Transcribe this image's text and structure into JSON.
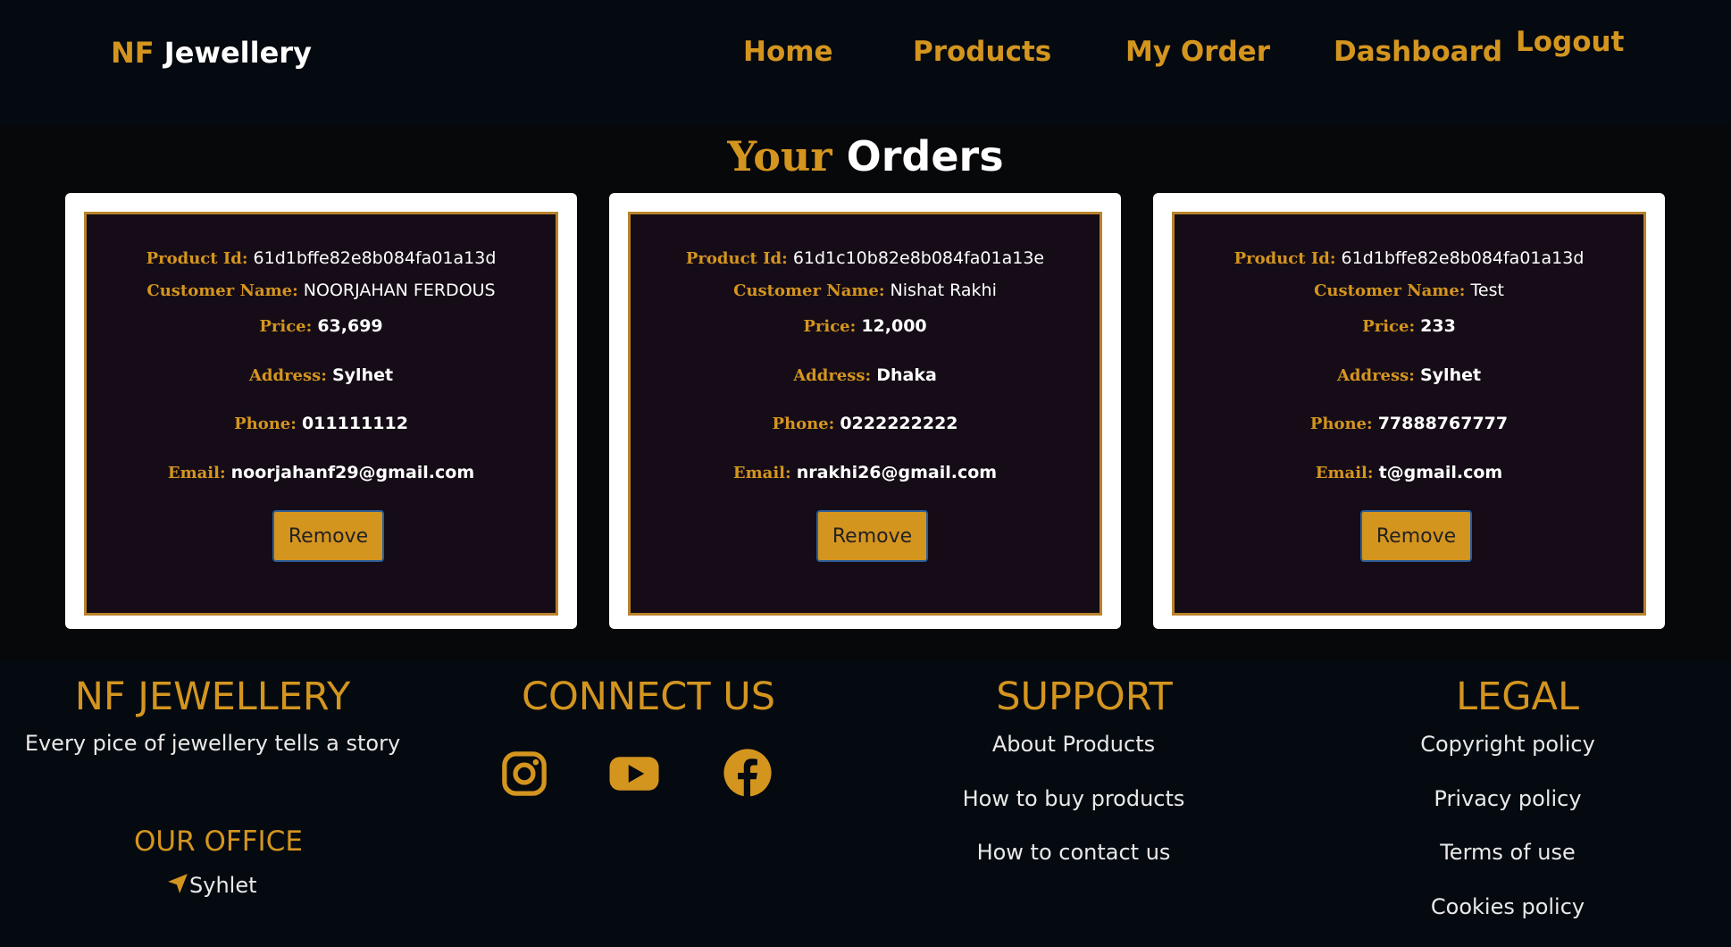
{
  "nav": {
    "brand_prefix": "NF",
    "brand_name": "Jewellery",
    "links": [
      "Home",
      "Products",
      "My Order",
      "Dashboard",
      "Logout"
    ]
  },
  "orders": {
    "title_prefix": "Your",
    "title_main": "Orders",
    "labels": {
      "product_id": "Product Id:",
      "customer_name": "Customer Name:",
      "price": "Price:",
      "address": "Address:",
      "phone": "Phone:",
      "email": "Email:"
    },
    "remove_label": "Remove",
    "items": [
      {
        "product_id": "61d1bffe82e8b084fa01a13d",
        "customer_name": "NOORJAHAN FERDOUS",
        "price": "63,699",
        "address": "Sylhet",
        "phone": "011111112",
        "email": "noorjahanf29@gmail.com"
      },
      {
        "product_id": "61d1c10b82e8b084fa01a13e",
        "customer_name": "Nishat Rakhi",
        "price": "12,000",
        "address": "Dhaka",
        "phone": "0222222222",
        "email": "nrakhi26@gmail.com"
      },
      {
        "product_id": "61d1bffe82e8b084fa01a13d",
        "customer_name": "Test",
        "price": "233",
        "address": "Sylhet",
        "phone": "77888767777",
        "email": "t@gmail.com"
      }
    ]
  },
  "footer": {
    "about": {
      "heading": "NF JEWELLERY",
      "tagline": "Every pice of jewellery tells a story",
      "office_heading": "OUR OFFICE",
      "office_location": "Syhlet"
    },
    "connect": {
      "heading": "CONNECT US",
      "icons": [
        "instagram-icon",
        "youtube-icon",
        "facebook-icon"
      ]
    },
    "support": {
      "heading": "SUPPORT",
      "links": [
        "About Products",
        "How to buy products",
        "How to contact us"
      ]
    },
    "legal": {
      "heading": "LEGAL",
      "links": [
        "Copyright policy",
        "Privacy policy",
        "Terms of use",
        "Cookies policy"
      ]
    }
  },
  "colors": {
    "accent": "#d4951f",
    "background": "#050a10",
    "card_inner": "#150c17",
    "card_border": "#b9832b"
  }
}
